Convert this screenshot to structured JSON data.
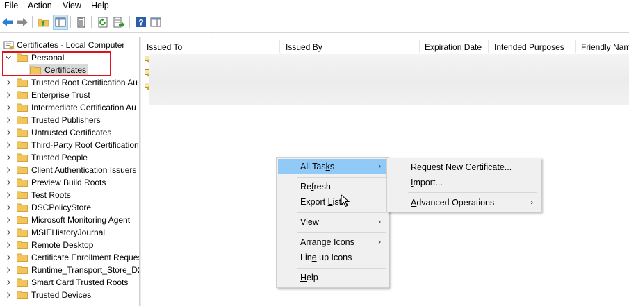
{
  "menubar": {
    "items": [
      "File",
      "Action",
      "View",
      "Help"
    ]
  },
  "toolbar": {
    "buttons": [
      "back-icon",
      "forward-icon",
      "up-folder-icon",
      "show-hide-tree-icon",
      "properties-icon",
      "refresh-icon",
      "export-list-icon",
      "help-icon",
      "show-hide-action-pane-icon"
    ]
  },
  "tree": {
    "root": "Certificates - Local Computer",
    "personal": "Personal",
    "personal_child": "Certificates",
    "stores": [
      "Trusted Root Certification Au",
      "Enterprise Trust",
      "Intermediate Certification Au",
      "Trusted Publishers",
      "Untrusted Certificates",
      "Third-Party Root Certification",
      "Trusted People",
      "Client Authentication Issuers",
      "Preview Build Roots",
      "Test Roots",
      "DSCPolicyStore",
      "Microsoft Monitoring Agent",
      "MSIEHistoryJournal",
      "Remote Desktop",
      "Certificate Enrollment Reques",
      "Runtime_Transport_Store_D2",
      "Smart Card Trusted Roots",
      "Trusted Devices"
    ]
  },
  "list": {
    "columns": [
      "Issued To",
      "Issued By",
      "Expiration Date",
      "Intended Purposes",
      "Friendly Nam"
    ]
  },
  "context_menu": {
    "items": [
      {
        "label": "All Tasks",
        "access": "k",
        "submenu": true
      },
      {
        "label": "Refresh",
        "access": "F",
        "submenu": false
      },
      {
        "label": "Export List...",
        "access": "L",
        "submenu": false
      },
      {
        "label": "View",
        "access": "V",
        "submenu": true
      },
      {
        "label": "Arrange Icons",
        "access": "I",
        "submenu": true
      },
      {
        "label": "Line up Icons",
        "access": "e",
        "submenu": false
      },
      {
        "label": "Help",
        "access": "H",
        "submenu": false
      }
    ]
  },
  "submenu": {
    "items": [
      {
        "label": "Request New Certificate...",
        "access": "R",
        "submenu": false
      },
      {
        "label": "Import...",
        "access": "I",
        "submenu": false
      },
      {
        "label": "Advanced Operations",
        "access": "A",
        "submenu": true
      }
    ]
  },
  "colors": {
    "highlight": "#91c9f7",
    "redbox": "#e0121b",
    "folder": "#f2c55c",
    "selection": "#d9d9d9"
  }
}
